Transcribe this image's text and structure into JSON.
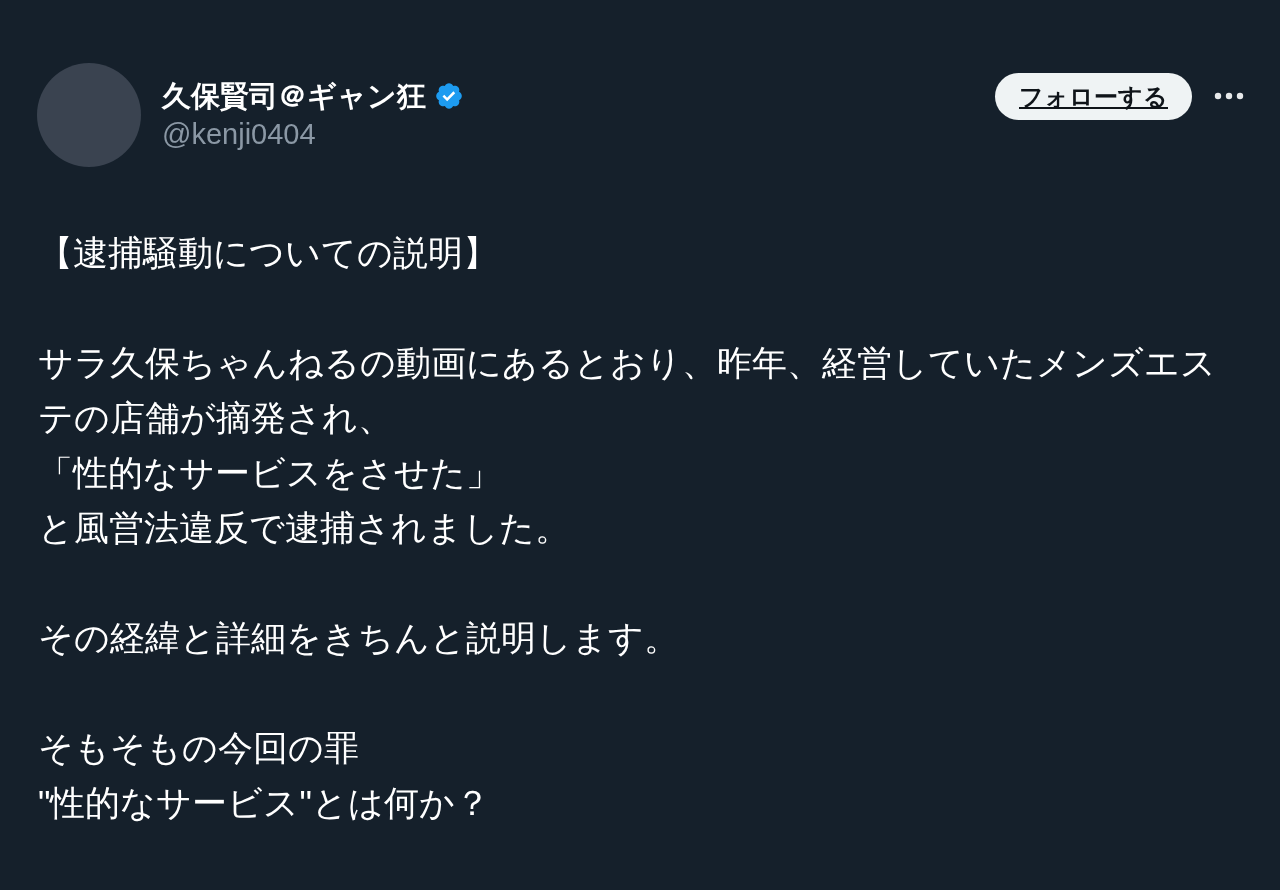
{
  "author": {
    "name": "久保賢司＠ギャン狂",
    "verified": true,
    "handle": "@kenji0404"
  },
  "follow_button": {
    "label": "フォローする"
  },
  "paragraphs": [
    [
      "【逮捕騒動についての説明】"
    ],
    [
      "サラ久保ちゃんねるの動画にあるとおり、昨年、経営していたメンズエステの店舗が摘発され、",
      "「性的なサービスをさせた」",
      "と風営法違反で逮捕されました。"
    ],
    [
      "その経緯と詳細をきちんと説明します。"
    ],
    [
      "そもそもの今回の罪",
      "\"性的なサービス\"とは何か？"
    ]
  ]
}
